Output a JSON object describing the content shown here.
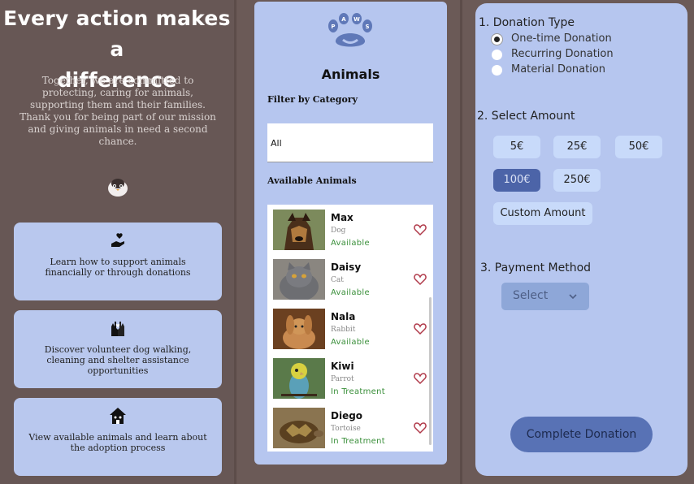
{
  "hero": {
    "title_line1": "Every action makes a",
    "title_line2": "difference",
    "text": "Together, we are committed to protecting, caring for animals, supporting them and their families. Thank you for being part of our mission and giving animals in need a second chance."
  },
  "cards": [
    {
      "icon": "hand-heart-icon",
      "text": "Learn how to support animals financially or through donations"
    },
    {
      "icon": "volunteer-hands-icon",
      "text": "Discover volunteer dog walking, cleaning and shelter assistance opportunities"
    },
    {
      "icon": "shelter-house-icon",
      "text": "View available animals and learn about the adoption process"
    }
  ],
  "animals_panel": {
    "logo_text": "PAWS",
    "title": "Animals",
    "filter_label": "Filter by Category",
    "filter_value": "All",
    "available_label": "Available Animals",
    "items": [
      {
        "name": "Max",
        "species": "Dog",
        "status": "Available",
        "photo": "dog-photo"
      },
      {
        "name": "Daisy",
        "species": "Cat",
        "status": "Available",
        "photo": "cat-photo"
      },
      {
        "name": "Nala",
        "species": "Rabbit",
        "status": "Available",
        "photo": "rabbit-photo"
      },
      {
        "name": "Kiwi",
        "species": "Parrot",
        "status": "In Treatment",
        "photo": "parrot-photo"
      },
      {
        "name": "Diego",
        "species": "Tortoise",
        "status": "In Treatment",
        "photo": "tortoise-photo"
      }
    ]
  },
  "donation": {
    "type_title": "1. Donation Type",
    "types": [
      {
        "label": "One-time Donation",
        "selected": true
      },
      {
        "label": "Recurring Donation",
        "selected": false
      },
      {
        "label": "Material Donation",
        "selected": false
      }
    ],
    "amount_title": "2. Select Amount",
    "amounts": [
      "5€",
      "25€",
      "50€",
      "100€",
      "250€"
    ],
    "selected_amount": "100€",
    "custom_amount": "Custom Amount",
    "payment_title": "3. Payment Method",
    "payment_select": "Select",
    "complete_button": "Complete Donation"
  },
  "colors": {
    "background": "#675755",
    "panel": "#b6c6ef",
    "selected_amount": "#4c64a8",
    "status_green": "#3a8f3a",
    "heart": "#b03a4a"
  }
}
